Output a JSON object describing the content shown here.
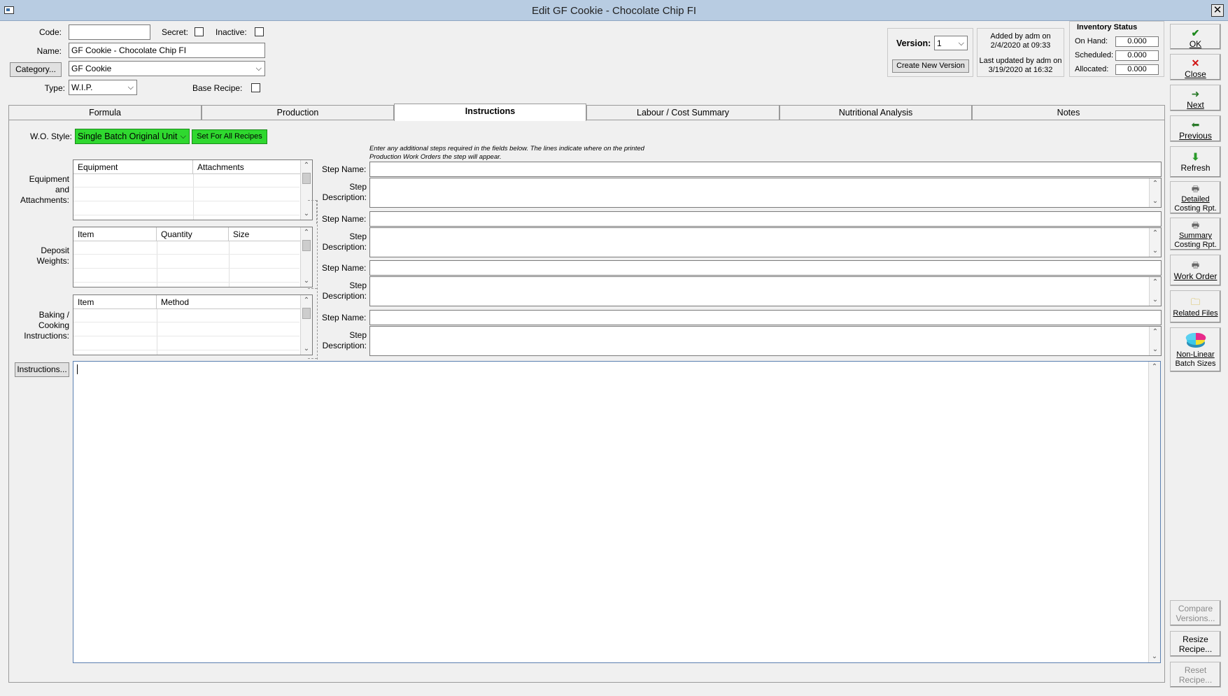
{
  "window": {
    "title": "Edit GF Cookie - Chocolate Chip FI",
    "close_glyph": "✕"
  },
  "header": {
    "code_label": "Code:",
    "code_value": "",
    "secret_label": "Secret:",
    "inactive_label": "Inactive:",
    "name_label": "Name:",
    "name_value": "GF Cookie - Chocolate Chip FI",
    "category_button": "Category...",
    "category_value": "GF Cookie",
    "type_label": "Type:",
    "type_value": "W.I.P.",
    "base_recipe_label": "Base Recipe:"
  },
  "version": {
    "label": "Version:",
    "value": "1",
    "create_button": "Create New Version",
    "added_line1": "Added by adm on",
    "added_line2": "2/4/2020 at 09:33",
    "updated_line1": "Last updated by adm on",
    "updated_line2": "3/19/2020 at 16:32"
  },
  "inventory": {
    "title": "Inventory Status",
    "on_hand_label": "On Hand:",
    "on_hand": "0.000",
    "scheduled_label": "Scheduled:",
    "scheduled": "0.000",
    "allocated_label": "Allocated:",
    "allocated": "0.000"
  },
  "tabs": [
    "Formula",
    "Production",
    "Instructions",
    "Labour / Cost Summary",
    "Nutritional Analysis",
    "Notes"
  ],
  "active_tab": "Instructions",
  "instructions": {
    "wo_style_label": "W.O. Style:",
    "wo_style_value": "Single Batch Original Unit",
    "set_all_button": "Set For All Recipes",
    "note_line1": "Enter any additional steps required in the fields below. The lines indicate where on the printed",
    "note_line2": "Production Work Orders the step will appear.",
    "equipment_label": [
      "Equipment",
      "and",
      "Attachments:"
    ],
    "equipment_cols": [
      "Equipment",
      "Attachments"
    ],
    "deposit_label": [
      "Deposit",
      "Weights:"
    ],
    "deposit_cols": [
      "Item",
      "Quantity",
      "Size"
    ],
    "baking_label": [
      "Baking /",
      "Cooking",
      "Instructions:"
    ],
    "baking_cols": [
      "Item",
      "Method"
    ],
    "step_name_label": "Step Name:",
    "step_desc_label1": "Step",
    "step_desc_label2": "Description:",
    "instructions_button": "Instructions...",
    "instructions_text": ""
  },
  "sidebar": {
    "ok": "OK",
    "close": "Close",
    "next": "Next",
    "previous": "Previous",
    "refresh": "Refresh",
    "detailed_1": "Detailed",
    "detailed_2": "Costing Rpt.",
    "summary_1": "Summary",
    "summary_2": "Costing Rpt.",
    "work_order": "Work Order",
    "related_files": "Related Files",
    "nonlinear_1": "Non-Linear",
    "nonlinear_2": "Batch Sizes",
    "compare_1": "Compare",
    "compare_2": "Versions...",
    "resize_1": "Resize",
    "resize_2": "Recipe...",
    "reset_1": "Reset",
    "reset_2": "Recipe..."
  },
  "colors": {
    "titlebar": "#b8cce2",
    "green_accent": "#2fd82f",
    "ok_check": "#1e8a1e",
    "close_x": "#d01010"
  }
}
